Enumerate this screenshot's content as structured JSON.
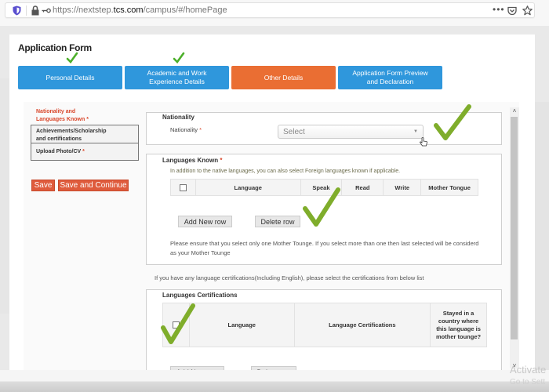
{
  "browser": {
    "url_prefix": "https://nextstep.",
    "url_domain": "tcs.com",
    "url_path": "/campus/#/homePage",
    "more_label": "•••",
    "icons": [
      "shield-icon",
      "lock-icon",
      "key-icon",
      "pocket-icon",
      "bookmark-star-icon"
    ]
  },
  "page": {
    "title": "Application Form"
  },
  "steps": [
    {
      "label": "Personal Details",
      "completed": true,
      "active": false
    },
    {
      "label": "Academic and Work Experience Details",
      "completed": true,
      "active": false
    },
    {
      "label": "Other Details",
      "completed": false,
      "active": true
    },
    {
      "label": "Application Form Preview and Declaration",
      "completed": false,
      "active": false
    }
  ],
  "steps_display": {
    "s0": "Personal Details",
    "s1a": "Academic and Work",
    "s1b": "Experience Details",
    "s2": "Other Details",
    "s3a": "Application Form Preview",
    "s3b": "and Declaration"
  },
  "sidebar": {
    "active_line1": "Nationality and",
    "active_line2": "Languages Known",
    "items": [
      {
        "line1": "Achievements/Scholarship",
        "line2": "and certifications",
        "required": false
      },
      {
        "line1": "Upload Photo/CV",
        "required": true
      }
    ],
    "required_mark": "*",
    "save_label": "Save",
    "save_continue_label": "Save and Continue"
  },
  "nationality": {
    "section_title": "Nationality",
    "field_label": "Nationality",
    "required_mark": "*",
    "select_value": "Select",
    "arrow": "▼"
  },
  "languages": {
    "section_title": "Languages Known",
    "required_mark": "*",
    "hint": "In addition to the native languages, you can also select Foreign languages known if applicable.",
    "columns": [
      "Language",
      "Speak",
      "Read",
      "Write",
      "Mother Tongue"
    ],
    "add_row_label": "Add New row",
    "delete_row_label": "Delete row",
    "note_line1": "Please ensure that you select only one Mother Tounge. If you select more than one then last selected will be considerd",
    "note_line2": "as your Mother Tounge"
  },
  "certifications": {
    "intro": "If you have any language certifications(Including English), please select the certifications from below list",
    "section_title": "Languages Certifications",
    "columns": [
      "Language",
      "Language Certifications"
    ],
    "stayed_col_line1": "Stayed in a",
    "stayed_col_line2": "country where",
    "stayed_col_line3": "this language is",
    "stayed_col_line4": "mother tounge?",
    "add_row_label": "Add New row",
    "delete_row_label": "Delete row"
  },
  "scroll": {
    "up": "˄",
    "down": "˅"
  },
  "overlay": {
    "activate_line1": "Activate",
    "activate_line2": "Go to Sett"
  },
  "colors": {
    "step_blue": "#2f97dc",
    "step_orange": "#ea6e33",
    "check_green": "#7fad2b",
    "required_red": "#d9472b"
  }
}
